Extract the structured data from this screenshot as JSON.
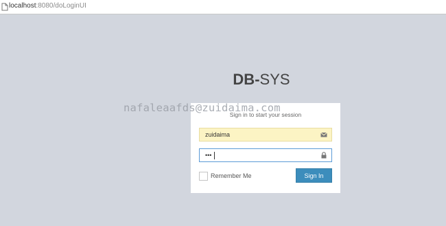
{
  "browser": {
    "url_host": "localhost",
    "url_path": ":8080/doLoginUI"
  },
  "logo": {
    "bold": "DB-",
    "light": "SYS"
  },
  "watermark": "nafaleaafds@zuidaima.com",
  "login": {
    "message": "Sign in to start your session",
    "username_value": "zuidaima",
    "password_value": "•••",
    "remember_label": "Remember Me",
    "signin_label": "Sign In"
  },
  "icons": {
    "url": "page-icon",
    "username": "envelope-icon",
    "password": "lock-icon"
  },
  "colors": {
    "background": "#d2d6de",
    "primary": "#3c8dbc",
    "autofill": "#fcf4c4"
  }
}
